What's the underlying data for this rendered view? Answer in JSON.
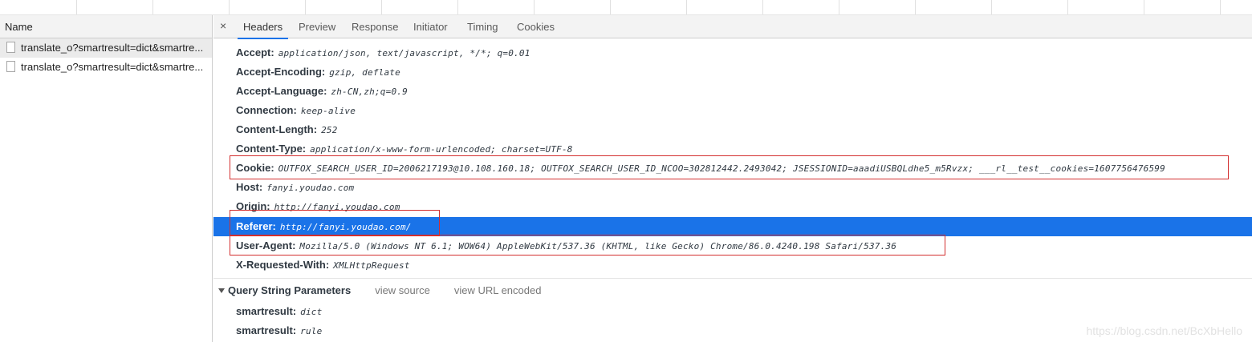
{
  "name_column": {
    "header": "Name"
  },
  "requests": [
    {
      "name": "translate_o?smartresult=dict&smartre..."
    },
    {
      "name": "translate_o?smartresult=dict&smartre..."
    }
  ],
  "tabs": {
    "close": "×",
    "items": [
      "Headers",
      "Preview",
      "Response",
      "Initiator",
      "Timing",
      "Cookies"
    ],
    "active": "Headers"
  },
  "request_headers": [
    {
      "key": "Accept:",
      "value": "application/json, text/javascript, */*; q=0.01"
    },
    {
      "key": "Accept-Encoding:",
      "value": "gzip, deflate"
    },
    {
      "key": "Accept-Language:",
      "value": "zh-CN,zh;q=0.9"
    },
    {
      "key": "Connection:",
      "value": "keep-alive"
    },
    {
      "key": "Content-Length:",
      "value": "252"
    },
    {
      "key": "Content-Type:",
      "value": "application/x-www-form-urlencoded; charset=UTF-8"
    },
    {
      "key": "Cookie:",
      "value": "OUTFOX_SEARCH_USER_ID=2006217193@10.108.160.18; OUTFOX_SEARCH_USER_ID_NCOO=302812442.2493042; JSESSIONID=aaadiUSBQLdhe5_m5Rvzx; ___rl__test__cookies=1607756476599"
    },
    {
      "key": "Host:",
      "value": "fanyi.youdao.com"
    },
    {
      "key": "Origin:",
      "value": "http://fanyi.youdao.com"
    },
    {
      "key": "Referer:",
      "value": "http://fanyi.youdao.com/"
    },
    {
      "key": "User-Agent:",
      "value": "Mozilla/5.0 (Windows NT 6.1; WOW64) AppleWebKit/537.36 (KHTML, like Gecko) Chrome/86.0.4240.198 Safari/537.36"
    },
    {
      "key": "X-Requested-With:",
      "value": "XMLHttpRequest"
    }
  ],
  "query_section": {
    "title": "Query String Parameters",
    "view_source": "view source",
    "view_url_encoded": "view URL encoded"
  },
  "query_params": [
    {
      "key": "smartresult:",
      "value": "dict"
    },
    {
      "key": "smartresult:",
      "value": "rule"
    }
  ],
  "watermark": "https://blog.csdn.net/BcXbHello",
  "colors": {
    "selection": "#1a73e8",
    "highlight_box": "#d32f2f"
  }
}
